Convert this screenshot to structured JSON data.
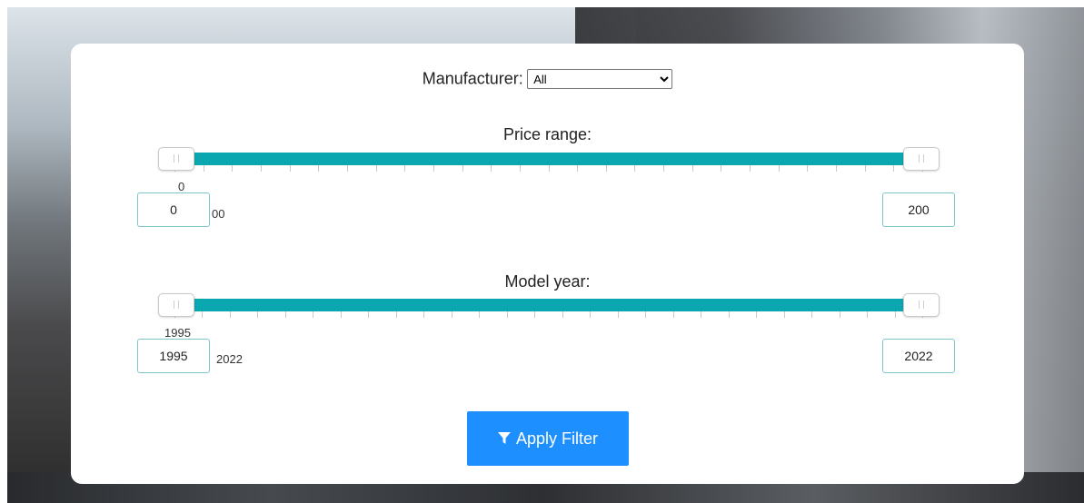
{
  "filters": {
    "manufacturer": {
      "label": "Manufacturer:",
      "selected": "All"
    },
    "price_range": {
      "label": "Price range:",
      "slider_min_label": "0",
      "slider_max_label_partial": "00",
      "min_value": "0",
      "max_value": "200",
      "range_min": 0,
      "range_max": 200,
      "selected_min": 0,
      "selected_max": 200,
      "track_color": "#0aa7b0"
    },
    "model_year": {
      "label": "Model year:",
      "slider_min_label": "1995",
      "slider_max_label": "2022",
      "min_value": "1995",
      "max_value": "2022",
      "range_min": 1995,
      "range_max": 2022,
      "selected_min": 1995,
      "selected_max": 2022,
      "track_color": "#0aa7b0"
    }
  },
  "actions": {
    "apply_label": "Apply Filter",
    "apply_icon": "filter-icon",
    "apply_color": "#1e8fff"
  }
}
